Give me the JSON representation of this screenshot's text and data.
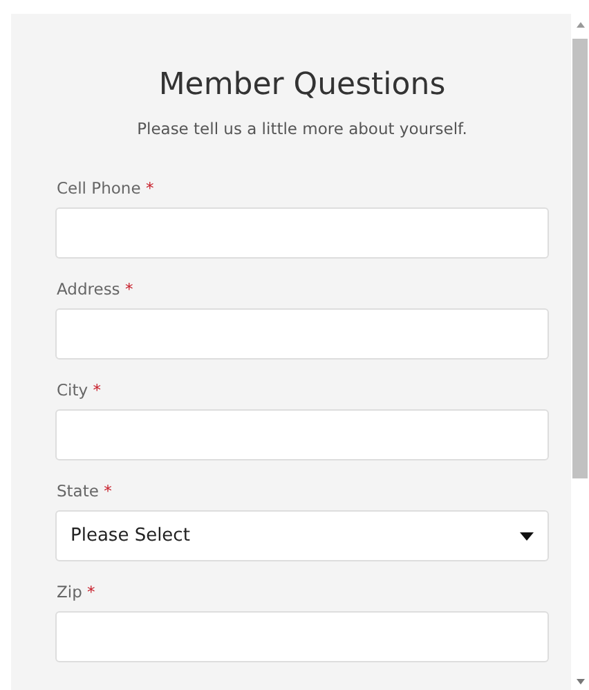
{
  "title": "Member Questions",
  "subtitle": "Please tell us a little more about yourself.",
  "fields": [
    {
      "kind": "text",
      "label": "Cell Phone",
      "required_mark": "*"
    },
    {
      "kind": "text",
      "label": "Address",
      "required_mark": "*"
    },
    {
      "kind": "text",
      "label": "City",
      "required_mark": "*"
    },
    {
      "kind": "select",
      "label": "State",
      "required_mark": "*",
      "value": "Please Select"
    },
    {
      "kind": "text",
      "label": "Zip",
      "required_mark": "*"
    }
  ]
}
